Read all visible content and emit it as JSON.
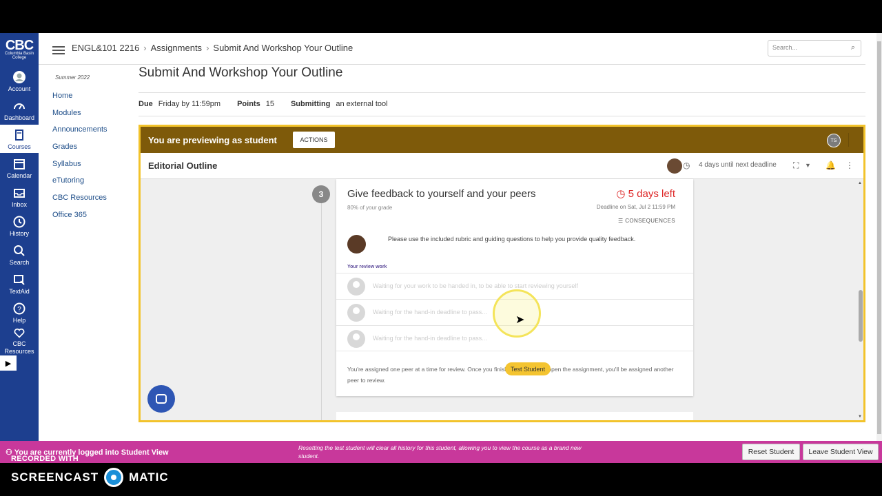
{
  "logo": {
    "big": "CBC",
    "small": "Columbia Basin College"
  },
  "global_nav": [
    {
      "label": "Account",
      "icon": "account-icon"
    },
    {
      "label": "Dashboard",
      "icon": "dashboard-icon"
    },
    {
      "label": "Courses",
      "icon": "courses-icon"
    },
    {
      "label": "Calendar",
      "icon": "calendar-icon"
    },
    {
      "label": "Inbox",
      "icon": "inbox-icon"
    },
    {
      "label": "History",
      "icon": "history-icon"
    },
    {
      "label": "Search",
      "icon": "search-icon"
    },
    {
      "label": "TextAid",
      "icon": "textaid-icon"
    },
    {
      "label": "Help",
      "icon": "help-icon"
    },
    {
      "label": "CBC\nResources",
      "icon": "heart-icon"
    }
  ],
  "breadcrumb": {
    "course": "ENGL&101 2216",
    "section": "Assignments",
    "page": "Submit And Workshop Your Outline",
    "sep": "›"
  },
  "search": {
    "placeholder": "Search..."
  },
  "course_nav": {
    "term": "Summer 2022",
    "items": [
      "Home",
      "Modules",
      "Announcements",
      "Grades",
      "Syllabus",
      "eTutoring",
      "CBC Resources",
      "Office 365"
    ]
  },
  "page": {
    "title": "Submit And Workshop Your Outline",
    "due_label": "Due",
    "due_value": "Friday by 11:59pm",
    "points_label": "Points",
    "points_value": "15",
    "submitting_label": "Submitting",
    "submitting_value": "an external tool"
  },
  "preview": {
    "banner": "You are previewing as student",
    "actions": "ACTIONS",
    "avatar_initials": "TS"
  },
  "editorial": {
    "title": "Editorial Outline",
    "deadline_note": "4 days until next deadline"
  },
  "step": {
    "number": "3",
    "title": "Give feedback to yourself and your peers",
    "grade": "80% of your grade",
    "days_left": "5 days left",
    "deadline": "Deadline on Sat, Jul 2 11:59 PM",
    "consequences": "CONSEQUENCES",
    "instruction": "Please use the included rubric and guiding questions to help you provide quality feedback.",
    "review_label": "Your review work",
    "rows": [
      "Waiting for your work to be handed in, to be able to start reviewing yourself",
      "Waiting for the hand-in deadline to pass...",
      "Waiting for the hand-in deadline to pass..."
    ],
    "footer": "You're assigned one peer at a time for review. Once you finish a review, or re-open the assignment, you'll be assigned another peer to review."
  },
  "tooltip": "Test Student",
  "student_view": {
    "logged_in": "You are currently logged into Student View",
    "reset_note": "Resetting the test student will clear all history for this student, allowing you to view the course as a brand new student.",
    "reset_button": "Reset Student",
    "leave_button": "Leave Student View"
  },
  "watermark": {
    "line1": "RECORDED WITH",
    "line2a": "SCREENCAST",
    "line2b": "MATIC"
  },
  "colors": {
    "nav": "#1d3f8f",
    "banner": "#7e5a0a",
    "frame": "#f2c32b",
    "student_bar": "#c8389b",
    "deadline_red": "#d22"
  }
}
